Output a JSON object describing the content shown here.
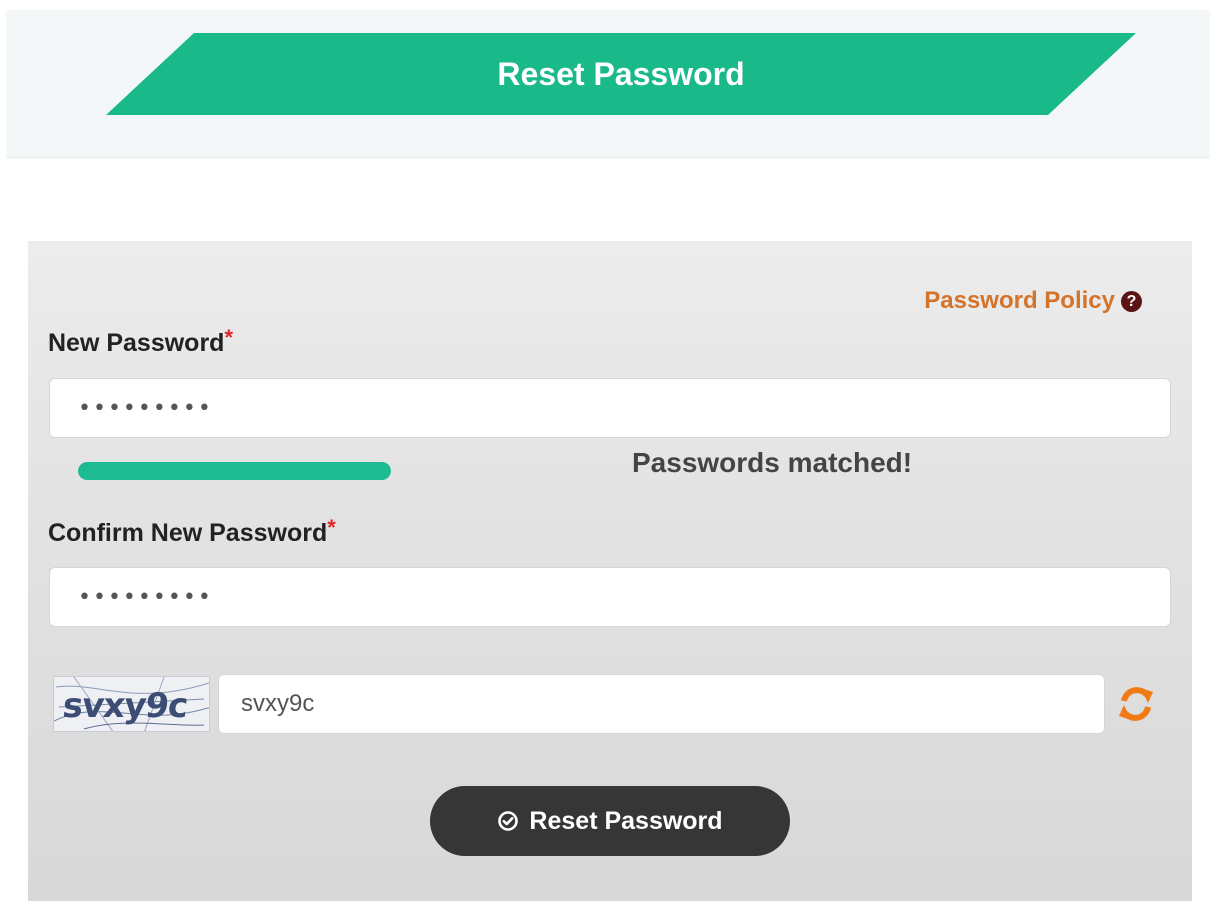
{
  "header": {
    "title": "Reset Password",
    "banner_color": "#1ab98a"
  },
  "form": {
    "policy_link": "Password Policy",
    "policy_icon": "question-circle-icon",
    "new_password": {
      "label": "New Password",
      "required_mark": "*",
      "value": "•••••••••"
    },
    "strength": {
      "fraction": 1.0,
      "color": "#1dbb91"
    },
    "match_message": "Passwords matched!",
    "confirm_password": {
      "label": "Confirm New Password",
      "required_mark": "*",
      "value": "•••••••••"
    },
    "captcha": {
      "image_text": "svxy9c",
      "input_value": "svxy9c",
      "refresh_icon": "refresh-icon"
    },
    "submit_label": "Reset Password",
    "submit_icon": "check-circle-icon"
  },
  "colors": {
    "accent_green": "#1ab98a",
    "policy_orange": "#d4732a",
    "refresh_orange": "#f07b14",
    "button_dark": "#363636",
    "required_red": "#e0262b"
  }
}
